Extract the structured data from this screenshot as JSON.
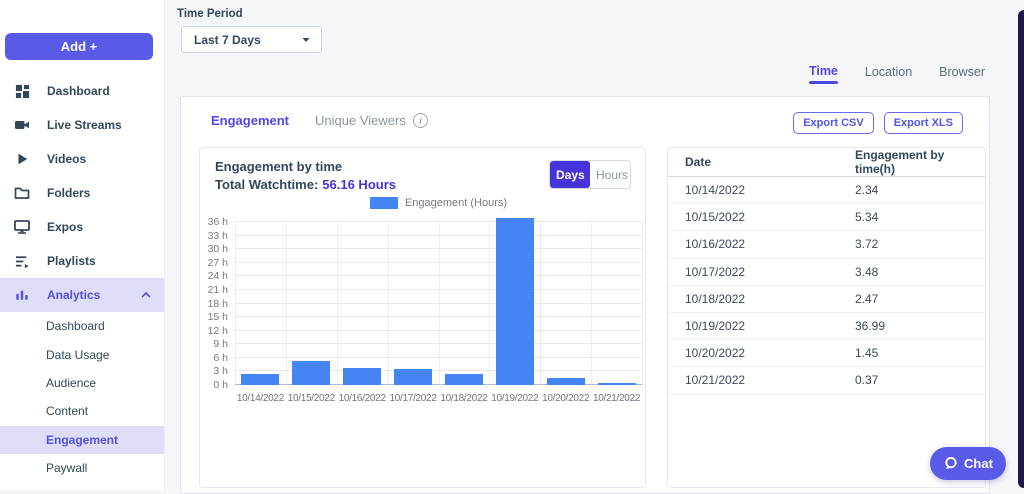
{
  "colors": {
    "accent_purple": "#5a5ae8",
    "deep_purple": "#4434d9",
    "active_tab_purple": "#4f46e5",
    "sidebar_highlight": "#deddf8",
    "bar_blue": "#4484f3",
    "text_dark": "#33475b"
  },
  "sidebar": {
    "add_button_label": "Add +",
    "items": [
      {
        "label": "Dashboard",
        "icon": "dashboard-icon"
      },
      {
        "label": "Live Streams",
        "icon": "live-streams-icon"
      },
      {
        "label": "Videos",
        "icon": "videos-icon"
      },
      {
        "label": "Folders",
        "icon": "folders-icon"
      },
      {
        "label": "Expos",
        "icon": "expos-icon"
      },
      {
        "label": "Playlists",
        "icon": "playlists-icon"
      },
      {
        "label": "Analytics",
        "icon": "analytics-icon",
        "active": true,
        "expanded": true
      }
    ],
    "analytics_children": [
      {
        "label": "Dashboard"
      },
      {
        "label": "Data Usage"
      },
      {
        "label": "Audience"
      },
      {
        "label": "Content"
      },
      {
        "label": "Engagement",
        "active": true
      },
      {
        "label": "Paywall"
      }
    ]
  },
  "filters": {
    "time_period_label": "Time Period",
    "time_period_value": "Last 7 Days"
  },
  "top_tabs": [
    {
      "label": "Time",
      "active": true
    },
    {
      "label": "Location",
      "active": false
    },
    {
      "label": "Browser",
      "active": false
    }
  ],
  "panel": {
    "tabs": [
      {
        "label": "Engagement",
        "active": true
      },
      {
        "label": "Unique Viewers",
        "active": false
      }
    ],
    "export_csv": "Export CSV",
    "export_xls": "Export XLS"
  },
  "chart_header": {
    "title": "Engagement by time",
    "total_label": "Total Watchtime:",
    "total_value": "56.16 Hours",
    "toggle": [
      {
        "label": "Days",
        "active": true
      },
      {
        "label": "Hours",
        "active": false
      }
    ]
  },
  "chart_data": {
    "type": "bar",
    "title": "Engagement by time",
    "series_name": "Engagement (Hours)",
    "categories": [
      "10/14/2022",
      "10/15/2022",
      "10/16/2022",
      "10/17/2022",
      "10/18/2022",
      "10/19/2022",
      "10/20/2022",
      "10/21/2022"
    ],
    "values": [
      2.34,
      5.34,
      3.72,
      3.48,
      2.47,
      36.99,
      1.45,
      0.37
    ],
    "xlabel": "",
    "ylabel": "",
    "ylim": [
      0,
      36
    ],
    "ytick_step": 3,
    "ytick_labels": [
      "0 h",
      "3 h",
      "6 h",
      "9 h",
      "12 h",
      "15 h",
      "18 h",
      "21 h",
      "24 h",
      "27 h",
      "30 h",
      "33 h",
      "36 h"
    ],
    "grid": true,
    "legend_position": "top",
    "bar_color": "#4484f3"
  },
  "table": {
    "headers": [
      "Date",
      "Engagement by time(h)"
    ],
    "rows": [
      [
        "10/14/2022",
        "2.34"
      ],
      [
        "10/15/2022",
        "5.34"
      ],
      [
        "10/16/2022",
        "3.72"
      ],
      [
        "10/17/2022",
        "3.48"
      ],
      [
        "10/18/2022",
        "2.47"
      ],
      [
        "10/19/2022",
        "36.99"
      ],
      [
        "10/20/2022",
        "1.45"
      ],
      [
        "10/21/2022",
        "0.37"
      ]
    ]
  },
  "chat": {
    "label": "Chat"
  }
}
